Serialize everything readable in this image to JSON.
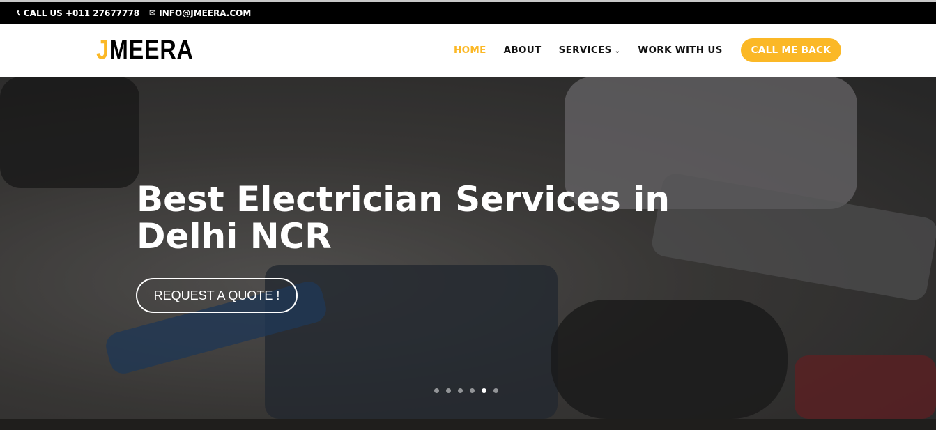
{
  "topbar": {
    "phone": "CALL US +011 27677778",
    "email": "INFO@JMEERA.COM",
    "phone_icon": "phone-icon",
    "email_icon": "envelope-icon"
  },
  "logo": {
    "first": "J",
    "rest": "MEERA"
  },
  "nav": {
    "items": [
      {
        "label": "HOME",
        "active": true
      },
      {
        "label": "ABOUT"
      },
      {
        "label": "SERVICES",
        "has_dropdown": true
      },
      {
        "label": "WORK WITH US"
      }
    ],
    "cta": "CALL ME BACK"
  },
  "hero": {
    "title": "Best Electrician Services in Delhi NCR",
    "button": "REQUEST A QUOTE !",
    "slides": 6,
    "active_slide": 5
  },
  "colors": {
    "accent": "#fbb826",
    "topbar": "#000000"
  }
}
